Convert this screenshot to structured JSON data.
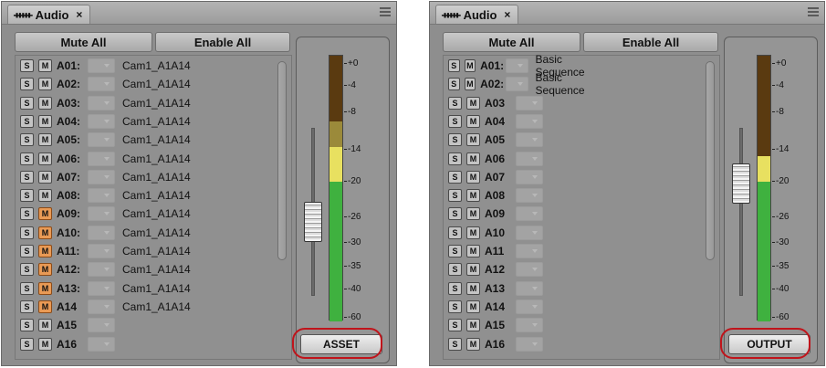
{
  "panels": [
    {
      "tab_title": "Audio",
      "tab_close": "×",
      "mute_all_label": "Mute All",
      "enable_all_label": "Enable All",
      "tracks": [
        {
          "s": "S",
          "m": "M",
          "name": "A01:",
          "clip": "Cam1_A1A14",
          "muted": false
        },
        {
          "s": "S",
          "m": "M",
          "name": "A02:",
          "clip": "Cam1_A1A14",
          "muted": false
        },
        {
          "s": "S",
          "m": "M",
          "name": "A03:",
          "clip": "Cam1_A1A14",
          "muted": false
        },
        {
          "s": "S",
          "m": "M",
          "name": "A04:",
          "clip": "Cam1_A1A14",
          "muted": false
        },
        {
          "s": "S",
          "m": "M",
          "name": "A05:",
          "clip": "Cam1_A1A14",
          "muted": false
        },
        {
          "s": "S",
          "m": "M",
          "name": "A06:",
          "clip": "Cam1_A1A14",
          "muted": false
        },
        {
          "s": "S",
          "m": "M",
          "name": "A07:",
          "clip": "Cam1_A1A14",
          "muted": false
        },
        {
          "s": "S",
          "m": "M",
          "name": "A08:",
          "clip": "Cam1_A1A14",
          "muted": false
        },
        {
          "s": "S",
          "m": "M",
          "name": "A09:",
          "clip": "Cam1_A1A14",
          "muted": true
        },
        {
          "s": "S",
          "m": "M",
          "name": "A10:",
          "clip": "Cam1_A1A14",
          "muted": true
        },
        {
          "s": "S",
          "m": "M",
          "name": "A11:",
          "clip": "Cam1_A1A14",
          "muted": true
        },
        {
          "s": "S",
          "m": "M",
          "name": "A12:",
          "clip": "Cam1_A1A14",
          "muted": true
        },
        {
          "s": "S",
          "m": "M",
          "name": "A13:",
          "clip": "Cam1_A1A14",
          "muted": true
        },
        {
          "s": "S",
          "m": "M",
          "name": "A14",
          "clip": "Cam1_A1A14",
          "muted": true
        },
        {
          "s": "S",
          "m": "M",
          "name": "A15",
          "clip": "",
          "muted": false
        },
        {
          "s": "S",
          "m": "M",
          "name": "A16",
          "clip": "",
          "muted": false
        }
      ],
      "meter_scale": [
        "+0",
        "-4",
        "-8",
        "-14",
        "-20",
        "-26",
        "-30",
        "-35",
        "-40",
        "-60"
      ],
      "fader_level": 0.42,
      "meter_mode_label": "ASSET",
      "highlight_color": "#c0141b",
      "muted_color": "#e99a55"
    },
    {
      "tab_title": "Audio",
      "tab_close": "×",
      "mute_all_label": "Mute All",
      "enable_all_label": "Enable All",
      "tracks": [
        {
          "s": "S",
          "m": "M",
          "name": "A01:",
          "clip": "Basic Sequence",
          "muted": false
        },
        {
          "s": "S",
          "m": "M",
          "name": "A02:",
          "clip": "Basic Sequence",
          "muted": false
        },
        {
          "s": "S",
          "m": "M",
          "name": "A03",
          "clip": "",
          "muted": false
        },
        {
          "s": "S",
          "m": "M",
          "name": "A04",
          "clip": "",
          "muted": false
        },
        {
          "s": "S",
          "m": "M",
          "name": "A05",
          "clip": "",
          "muted": false
        },
        {
          "s": "S",
          "m": "M",
          "name": "A06",
          "clip": "",
          "muted": false
        },
        {
          "s": "S",
          "m": "M",
          "name": "A07",
          "clip": "",
          "muted": false
        },
        {
          "s": "S",
          "m": "M",
          "name": "A08",
          "clip": "",
          "muted": false
        },
        {
          "s": "S",
          "m": "M",
          "name": "A09",
          "clip": "",
          "muted": false
        },
        {
          "s": "S",
          "m": "M",
          "name": "A10",
          "clip": "",
          "muted": false
        },
        {
          "s": "S",
          "m": "M",
          "name": "A11",
          "clip": "",
          "muted": false
        },
        {
          "s": "S",
          "m": "M",
          "name": "A12",
          "clip": "",
          "muted": false
        },
        {
          "s": "S",
          "m": "M",
          "name": "A13",
          "clip": "",
          "muted": false
        },
        {
          "s": "S",
          "m": "M",
          "name": "A14",
          "clip": "",
          "muted": false
        },
        {
          "s": "S",
          "m": "M",
          "name": "A15",
          "clip": "",
          "muted": false
        },
        {
          "s": "S",
          "m": "M",
          "name": "A16",
          "clip": "",
          "muted": false
        }
      ],
      "meter_scale": [
        "+0",
        "-4",
        "-8",
        "-14",
        "-20",
        "-26",
        "-30",
        "-35",
        "-40",
        "-60"
      ],
      "fader_level": 0.72,
      "meter_mode_label": "OUTPUT",
      "highlight_color": "#c0141b",
      "muted_color": "#e99a55"
    }
  ]
}
